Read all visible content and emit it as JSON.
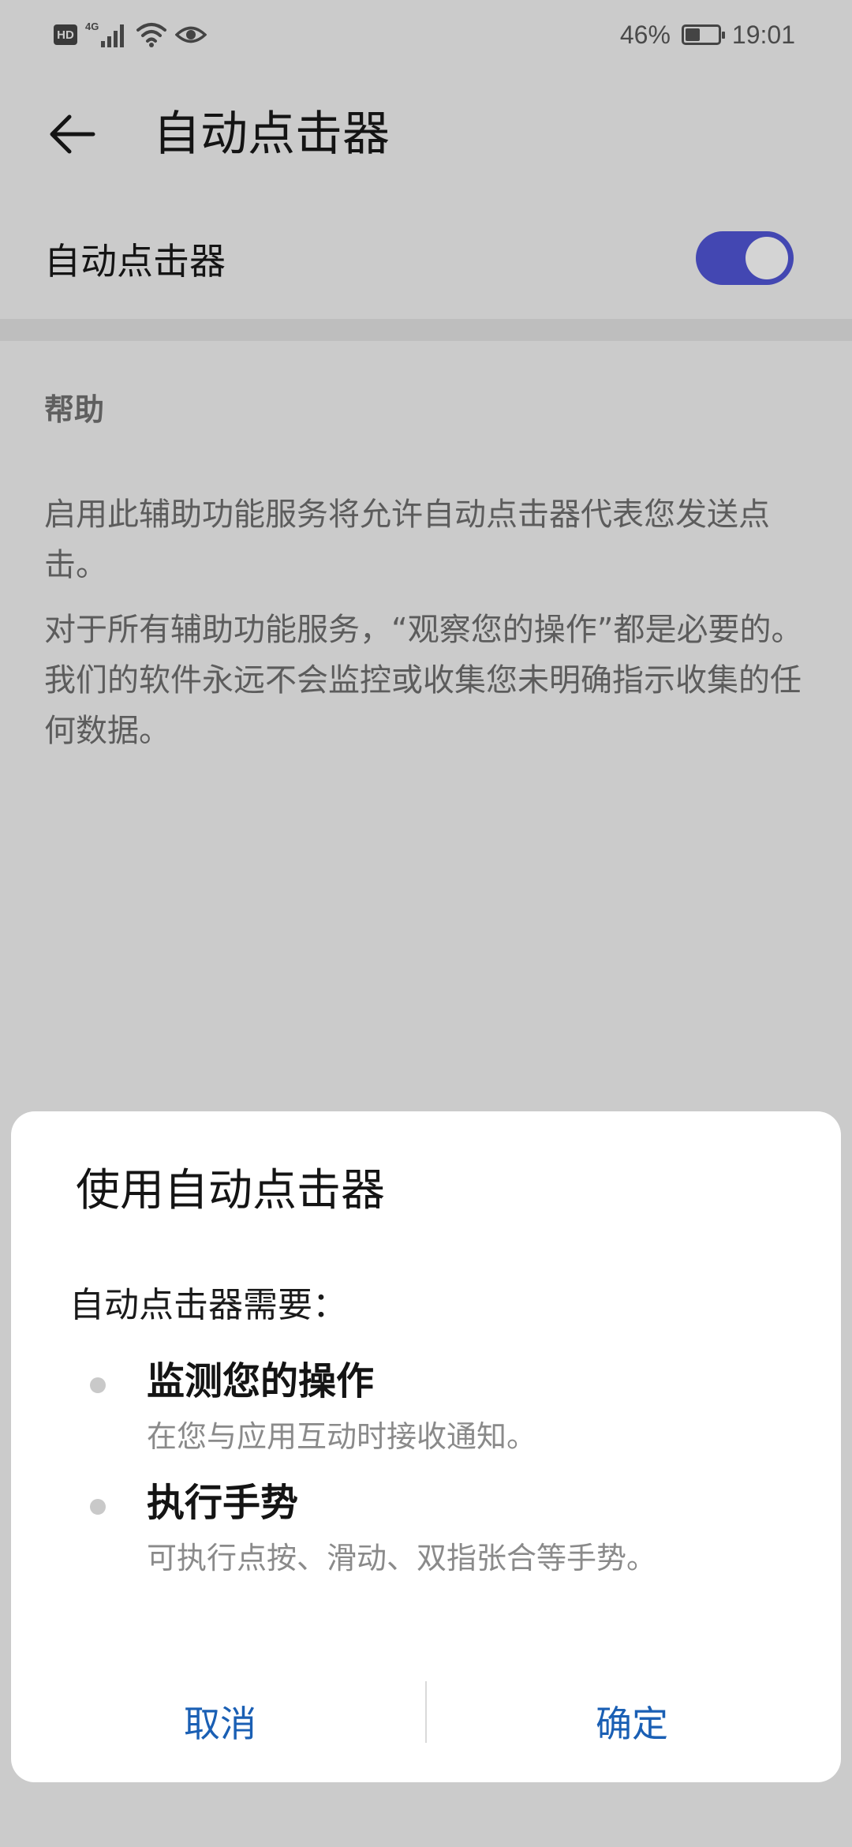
{
  "status_bar": {
    "network_type": "4G",
    "battery_percent": "46%",
    "time": "19:01",
    "battery_level": 0.46,
    "icons": [
      "hd-icon",
      "signal-icon",
      "wifi-icon",
      "eye-icon",
      "battery-icon"
    ]
  },
  "appbar": {
    "title": "自动点击器",
    "back_icon": "arrow-left-icon"
  },
  "main_toggle": {
    "label": "自动点击器",
    "state": "on",
    "accent_color": "#4347b2"
  },
  "help": {
    "header": "帮助",
    "paragraph_1": "启用此辅助功能服务将允许自动点击器代表您发送点击。",
    "paragraph_2": "对于所有辅助功能服务，“观察您的操作”都是必要的。我们的软件永远不会监控或收集您未明确指示收集的任何数据。"
  },
  "dialog": {
    "title": "使用自动点击器",
    "intro": "自动点击器需要：",
    "permissions": [
      {
        "title": "监测您的操作",
        "description": "在您与应用互动时接收通知。"
      },
      {
        "title": "执行手势",
        "description": "可执行点按、滑动、双指张合等手势。"
      }
    ],
    "cancel_label": "取消",
    "confirm_label": "确定",
    "button_color": "#1a5fb4"
  }
}
